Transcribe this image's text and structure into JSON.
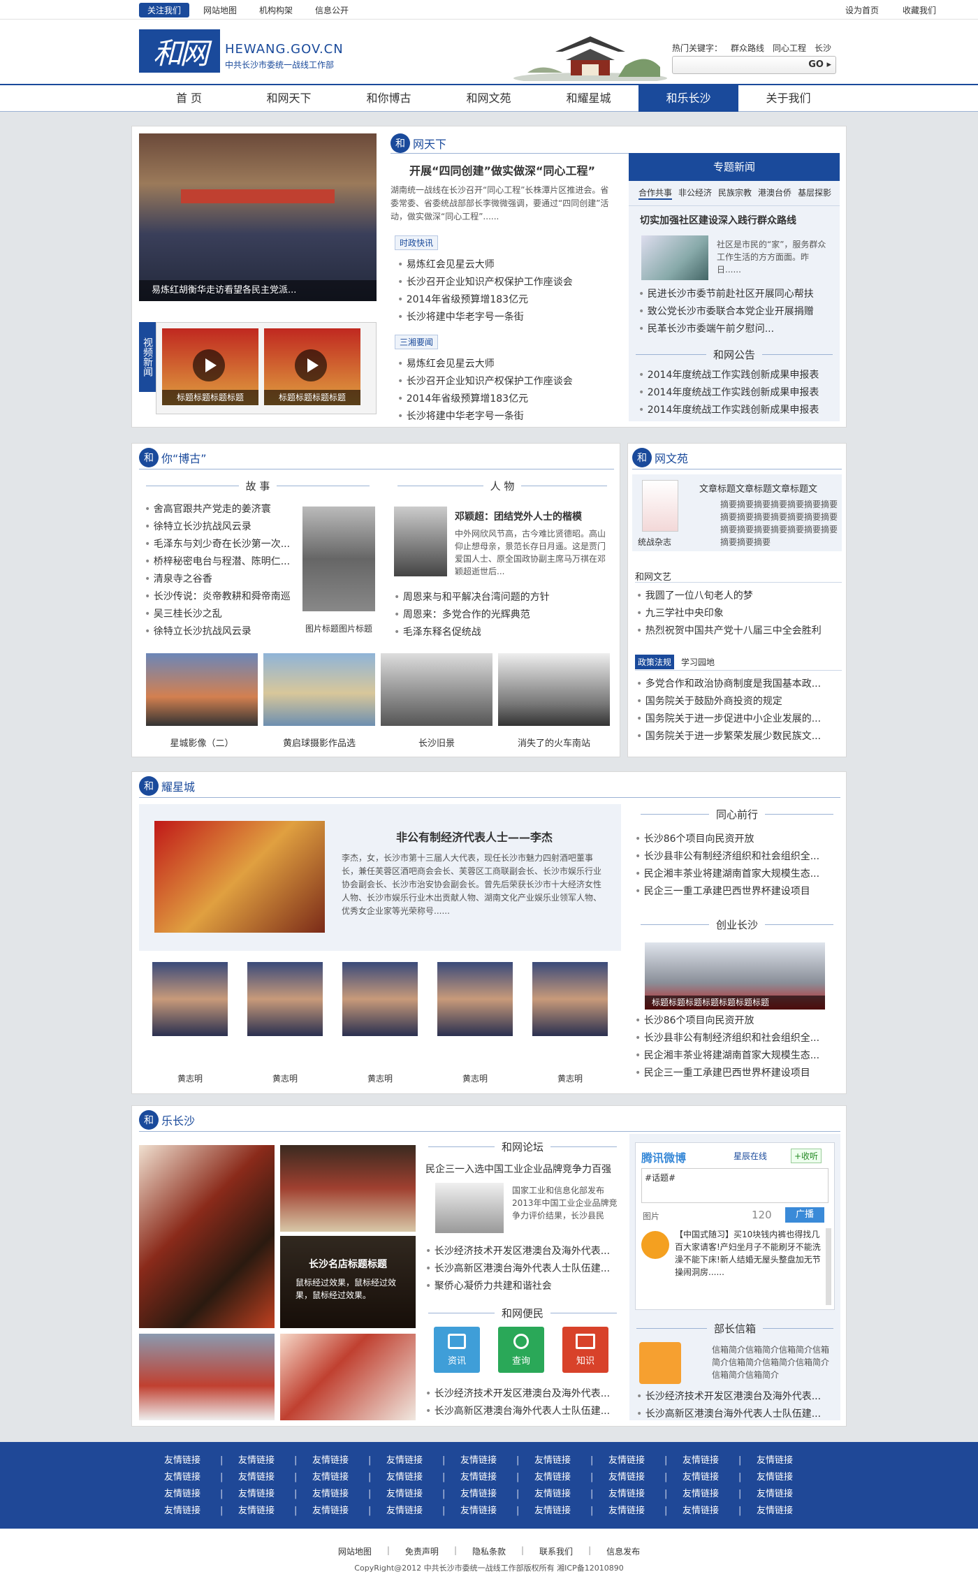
{
  "topbar": {
    "links": [
      "关注我们",
      "网站地图",
      "机构构架",
      "信息公开"
    ],
    "right": [
      "设为首页",
      "收藏我们"
    ]
  },
  "header": {
    "logo_text": "和网",
    "domain": "HEWANG.GOV.CN",
    "org": "中共长沙市委统一战线工作部",
    "hot_label": "热门关键字：",
    "hot": [
      "群众路线",
      "同心工程",
      "长沙"
    ],
    "search_btn": "GO ▸"
  },
  "nav": [
    "首 页",
    "和网天下",
    "和你博古",
    "和网文苑",
    "和耀星城",
    "和乐长沙",
    "关于我们"
  ],
  "s1": {
    "title": "网天下",
    "photo_caption": "易炼红胡衡华走访看望各民主党派...",
    "video_label": "视频新闻",
    "video_caps": [
      "标题标题标题标题",
      "标题标题标题标题"
    ],
    "headline": "开展“四同创建”做实做深“同心工程”",
    "summary": "湖南统一战线在长沙召开“同心工程”长株潭片区推进会。省委常委、省委统战部部长李微微强调，要通过“四同创建”活动，做实做深“同心工程”......",
    "tag1": "时政快讯",
    "list1": [
      "易炼红会见星云大师",
      "长沙召开企业知识产权保护工作座谈会",
      "2014年省级预算增183亿元",
      "长沙将建中华老字号一条街"
    ],
    "tag2": "三湘要闻",
    "list2": [
      "易炼红会见星云大师",
      "长沙召开企业知识产权保护工作座谈会",
      "2014年省级预算增183亿元",
      "长沙将建中华老字号一条街"
    ],
    "topic_title": "专题新闻",
    "topic_tabs": [
      "合作共事",
      "非公经济",
      "民族宗教",
      "港澳台侨",
      "基层探影"
    ],
    "topic_head": "切实加强社区建设深入践行群众路线",
    "topic_text": "社区是市民的“家”，服务群众工作生活的方方面面。昨日......",
    "topic_list": [
      "民进长沙市委节前赴社区开展同心帮扶",
      "致公党长沙市委联合本党企业开展捐赠",
      "民革长沙市委端午前夕慰问..."
    ],
    "notice_title": "和网公告",
    "notice_list": [
      "2014年度统战工作实践创新成果申报表",
      "2014年度统战工作实践创新成果申报表",
      "2014年度统战工作实践创新成果申报表"
    ]
  },
  "s2": {
    "title": "你“博古”",
    "story_head": "故 事",
    "stories": [
      "舍高官跟共产党走的姜济寰",
      "徐特立长沙抗战风云录",
      "毛泽东与刘少奇在长沙第一次...",
      "桥梓秘密电台与程潜、陈明仁...",
      "清泉寺之谷香",
      "长沙传说：炎帝教耕和舜帝南巡",
      "吴三桂长沙之乱",
      "徐特立长沙抗战风云录"
    ],
    "photo_caption": "图片标题图片标题",
    "people_head": "人 物",
    "person_name": "邓颖超：团结党外人士的楷模",
    "person_text": "中外网欣风节高，古今难比贤德昭。高山仰止想母亲，景范长存日月遥。这是贾门爱国人士、原全国政协副主席马万祺在邓颖超逝世后...",
    "people": [
      "周恩来与和平解决台湾问题的方针",
      "周恩来：多党合作的光辉典范",
      "毛泽东释名促统战"
    ],
    "gallery": [
      "星城影像（二）",
      "黄启球摄影作品选",
      "长沙旧景",
      "消失了的火车南站"
    ]
  },
  "s3": {
    "title": "网文苑",
    "book_cap": "统战杂志",
    "book_title": "文章标题文章标题文章标题文",
    "book_text": "摘要摘要摘要摘要摘要摘要摘要摘要摘要摘要摘要摘要摘要摘要摘要摘要摘要摘要摘要摘要摘要摘要摘要摘要",
    "arts_head": "和网文艺",
    "arts": [
      "我圆了一位八旬老人的梦",
      "九三学社中央印象",
      "热烈祝贺中国共产党十八届三中全会胜利"
    ],
    "tabs": [
      "政策法规",
      "学习园地"
    ],
    "policy": [
      "多党合作和政治协商制度是我国基本政...",
      "国务院关于鼓励外商投资的规定",
      "国务院关于进一步促进中小企业发展的...",
      "国务院关于进一步繁荣发展少数民族文..."
    ]
  },
  "s4": {
    "title": "耀星城",
    "feature_title": "非公有制经济代表人士——李杰",
    "feature_text": "李杰，女，长沙市第十三届人大代表，现任长沙市魅力四射酒吧董事长，兼任芙蓉区酒吧商会会长、芙蓉区工商联副会长、长沙市娱乐行业协会副会长、长沙市治安协会副会长。曾先后荣获长沙市十大经济女性人物、长沙市娱乐行业木出贡献人物、湖南文化产业娱乐业领军人物、优秀女企业家等光荣称号......",
    "people": [
      "黄志明",
      "黄志明",
      "黄志明",
      "黄志明",
      "黄志明"
    ],
    "together_head": "同心前行",
    "together": [
      "长沙86个项目向民资开放",
      "长沙县非公有制经济组织和社会组织全...",
      "民企湘丰茶业将建湖南首家大规模生态...",
      "民企三一重工承建巴西世界杯建设项目"
    ],
    "startup_head": "创业长沙",
    "startup_cap": "标题标题标题标题标题标题标题",
    "startup": [
      "长沙86个项目向民资开放",
      "长沙县非公有制经济组织和社会组织全...",
      "民企湘丰茶业将建湖南首家大规模生态...",
      "民企三一重工承建巴西世界杯建设项目"
    ]
  },
  "s5": {
    "title": "乐长沙",
    "store_cap": "长沙名店标题标题",
    "store_text": "鼠标经过效果，鼠标经过效果，鼠标经过效果。",
    "forum_head": "和网论坛",
    "forum_title": "民企三一入选中国工业企业品牌竞争力百强",
    "forum_text": "国家工业和信息化部发布2013年中国工业企业品牌竞争力评价结果，长沙县民",
    "forum_list": [
      "长沙经济技术开发区港澳台及海外代表...",
      "长沙高新区港澳台海外代表人士队伍建...",
      "聚侨心凝侨力共建和谐社会"
    ],
    "service_head": "和网便民",
    "services": [
      "资讯",
      "查询",
      "知识"
    ],
    "service_list": [
      "长沙经济技术开发区港澳台及海外代表...",
      "长沙高新区港澳台海外代表人士队伍建..."
    ],
    "weibo": {
      "brand": "腾讯微博",
      "account": "星辰在线",
      "follow": "+收听",
      "hashtag": "#话题#",
      "pic": "图片",
      "count": "120",
      "send": "广播",
      "post": "【中国式随习】买10块钱内裤也得找几百大家请客!产妇坐月子不能刷牙不能洗澡不能下床!新人结婚无屋头整盘加无节操闹洞房......"
    },
    "mail_head": "部长信箱",
    "mail_text": "信箱简介信箱简介信箱简介信箱简介信箱简介信箱简介信箱简介信箱简介信箱简介",
    "mail_list": [
      "长沙经济技术开发区港澳台及海外代表...",
      "长沙高新区港澳台海外代表人士队伍建..."
    ]
  },
  "footer": {
    "link": "友情链接",
    "links_count": 36,
    "bottom_links": [
      "网站地图",
      "免责声明",
      "隐私条款",
      "联系我们",
      "信息发布"
    ],
    "copyright": "CopyRight@2012  中共长沙市委统一战线工作部版权所有   湘ICP备12010890"
  },
  "colors": {
    "brand": "#1a4a9b",
    "footer": "#1f4897",
    "bg": "#e2e5e8"
  }
}
